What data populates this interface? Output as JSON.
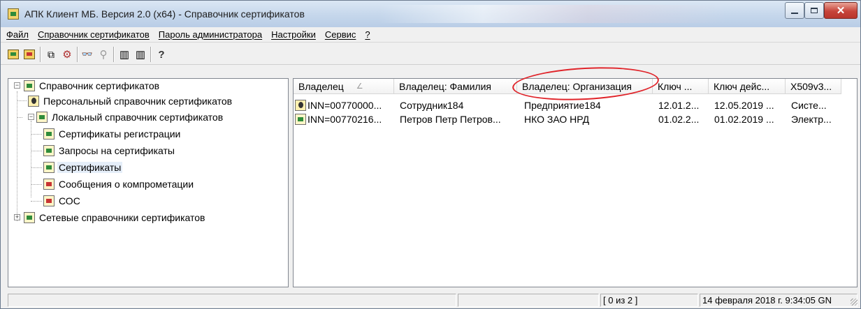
{
  "window": {
    "title": "АПК Клиент МБ. Версия 2.0 (x64) - Справочник сертификатов"
  },
  "menu": [
    {
      "label": "Файл"
    },
    {
      "label": "Справочник сертификатов"
    },
    {
      "label": "Пароль администратора"
    },
    {
      "label": "Настройки"
    },
    {
      "label": "Сервис"
    },
    {
      "label": "?"
    }
  ],
  "toolbar": {
    "find_glyph": "👓",
    "filter_glyph": "⚲",
    "help_glyph": "?"
  },
  "tree": {
    "root": "Справочник сертификатов",
    "personal": "Персональный справочник сертификатов",
    "local": "Локальный справочник сертификатов",
    "reg_certs": "Сертификаты регистрации",
    "requests": "Запросы на сертификаты",
    "certs": "Сертификаты",
    "compromise": "Сообщения о компрометации",
    "crl": "СОС",
    "network": "Сетевые справочники сертификатов",
    "expand_minus": "−",
    "expand_plus": "+"
  },
  "table": {
    "columns": [
      "Владелец",
      "Владелец: Фамилия",
      "Владелец: Организация",
      "Ключ ...",
      "Ключ дейс...",
      "X509v3..."
    ],
    "sort_indicator": "∠",
    "rows": [
      [
        "INN=00770000...",
        "Сотрудник184",
        "Предприятие184",
        "12.01.2...",
        "12.05.2019 ...",
        "Систе..."
      ],
      [
        "INN=00770216...",
        "Петров Петр Петров...",
        "НКО ЗАО НРД",
        "01.02.2...",
        "01.02.2019 ...",
        "Электр..."
      ]
    ]
  },
  "status": {
    "count": "[ 0 из 2 ]",
    "datetime": "14 февраля 2018 г. 9:34:05 GN"
  },
  "colors": {
    "highlight_ring": "#e0242a",
    "selection": "#e5eef9"
  }
}
